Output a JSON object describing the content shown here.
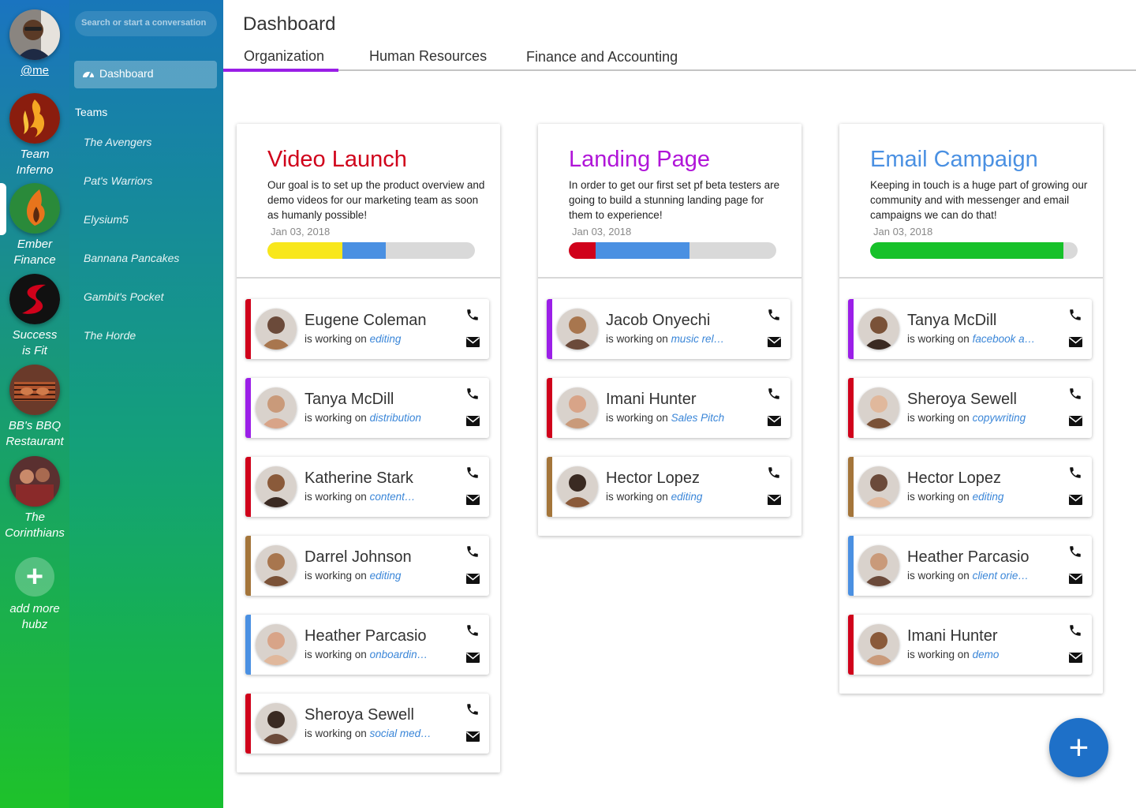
{
  "hubs": [
    {
      "label": "@me",
      "icon": "profile-avatar"
    },
    {
      "label": "Team Inferno",
      "icon": "flame-logo"
    },
    {
      "label": "Ember Finance",
      "icon": "ember-logo"
    },
    {
      "label": "Success is Fit",
      "icon": "swoosh-logo"
    },
    {
      "label": "BB's BBQ Restaurant",
      "icon": "bbq-photo"
    },
    {
      "label": "The Corinthians",
      "icon": "team-photo"
    }
  ],
  "add_hub_label": "add more hubz",
  "sidebar": {
    "search_placeholder": "Search or start a conversation",
    "dashboard_label": "Dashboard",
    "teams_heading": "Teams",
    "teams": [
      "The Avengers",
      "Pat's Warriors",
      "Elysium5",
      "Bannana Pancakes",
      "Gambit's Pocket",
      "The Horde"
    ]
  },
  "header": {
    "title": "Dashboard",
    "tabs": [
      "Organization",
      "Human Resources",
      "Finance and Accounting"
    ],
    "active_tab": "Organization"
  },
  "working_on_label": "is working on",
  "colors": {
    "red": "#d0021b",
    "purple": "#9b1fe8",
    "blue": "#4a90e2",
    "brown": "#a4753a",
    "yellow": "#f8e71c",
    "green": "#17c12a"
  },
  "projects": [
    {
      "title": "Video Launch",
      "title_color": "#d0021b",
      "description": "Our goal is to set up the product overview and demo videos for our marketing team as soon as humanly possible!",
      "date": "Jan 03, 2018",
      "progress": [
        {
          "color": "#f8e71c",
          "percent": 36
        },
        {
          "color": "#4a90e2",
          "percent": 21
        }
      ],
      "members": [
        {
          "name": "Eugene Coleman",
          "task": "editing",
          "stripe": "#d0021b"
        },
        {
          "name": "Tanya McDill",
          "task": "distribution",
          "stripe": "#9b1fe8"
        },
        {
          "name": "Katherine Stark",
          "task": "content…",
          "stripe": "#d0021b"
        },
        {
          "name": "Darrel Johnson",
          "task": "editing",
          "stripe": "#a4753a"
        },
        {
          "name": "Heather Parcasio",
          "task": "onboardin…",
          "stripe": "#4a90e2"
        },
        {
          "name": "Sheroya Sewell",
          "task": "social med…",
          "stripe": "#d0021b"
        }
      ]
    },
    {
      "title": "Landing Page",
      "title_color": "#b015d8",
      "description": "In order to get our first set pf beta testers are going to build a stunning landing page for them to experience!",
      "date": "Jan 03, 2018",
      "progress": [
        {
          "color": "#d0021b",
          "percent": 13
        },
        {
          "color": "#4a90e2",
          "percent": 45
        }
      ],
      "members": [
        {
          "name": "Jacob Onyechi",
          "task": "music rel…",
          "stripe": "#9b1fe8"
        },
        {
          "name": "Imani Hunter",
          "task": "Sales Pitch",
          "stripe": "#d0021b"
        },
        {
          "name": "Hector Lopez",
          "task": "editing",
          "stripe": "#a4753a"
        }
      ]
    },
    {
      "title": "Email Campaign",
      "title_color": "#4a90e2",
      "description": "Keeping in touch is a huge part of growing our community and with messenger and email campaigns we can do that!",
      "date": "Jan 03, 2018",
      "progress": [
        {
          "color": "#17c12a",
          "percent": 93
        }
      ],
      "members": [
        {
          "name": "Tanya McDill",
          "task": "facebook a…",
          "stripe": "#9b1fe8"
        },
        {
          "name": "Sheroya Sewell",
          "task": "copywriting",
          "stripe": "#d0021b"
        },
        {
          "name": "Hector Lopez",
          "task": "editing",
          "stripe": "#a4753a"
        },
        {
          "name": "Heather Parcasio",
          "task": "client orie…",
          "stripe": "#4a90e2"
        },
        {
          "name": "Imani Hunter",
          "task": "demo",
          "stripe": "#d0021b"
        }
      ]
    }
  ],
  "fab_label": "+"
}
